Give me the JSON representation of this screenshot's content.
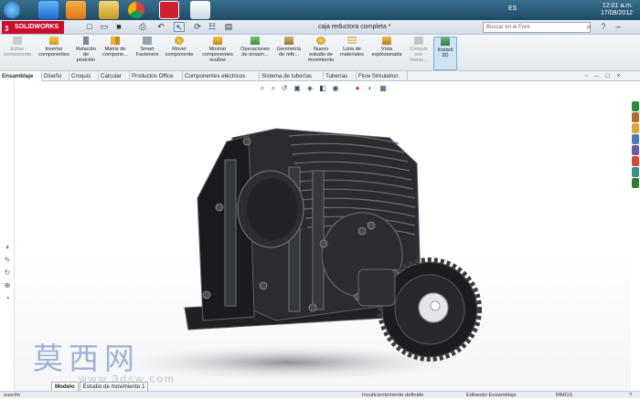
{
  "taskbar": {
    "language": "ES",
    "time": "12:01 a.m.",
    "date": "17/08/2012",
    "icons": [
      "start-orb-icon",
      "internet-explorer-icon",
      "media-player-icon",
      "explorer-icon",
      "chrome-icon",
      "solidworks-icon",
      "paint-icon"
    ]
  },
  "titlebar": {
    "app_name": "SOLIDWORKS",
    "document_title": "caja reductora completa *",
    "search_placeholder": "Buscar en el Foro"
  },
  "command_manager": {
    "buttons": [
      {
        "label": "Editar componente",
        "enabled": false
      },
      {
        "label": "Insertar componentes",
        "enabled": true
      },
      {
        "label": "Relación de posición",
        "enabled": true
      },
      {
        "label": "Matriz de compone...",
        "enabled": true
      },
      {
        "label": "Smart Fasteners",
        "enabled": true
      },
      {
        "label": "Mover componente",
        "enabled": true
      },
      {
        "label": "Mostrar componentes ocultos",
        "enabled": true
      },
      {
        "label": "Operaciones de ensam...",
        "enabled": true
      },
      {
        "label": "Geometría de refe...",
        "enabled": true
      },
      {
        "label": "Nuevo estudio de movimiento",
        "enabled": true
      },
      {
        "label": "Lista de materiales",
        "enabled": true
      },
      {
        "label": "Vista explosionada",
        "enabled": true
      },
      {
        "label": "Croquis con líneas...",
        "enabled": false
      },
      {
        "label": "Instant 3D",
        "enabled": true
      }
    ]
  },
  "tabs": [
    "Ensamblaje",
    "Diseño",
    "Croquis",
    "Calcular",
    "Productos Office",
    "Componentes eléctricos",
    "Sistema de tuberías",
    "Tuberías",
    "Flow Simulation"
  ],
  "active_tab": "Ensamblaje",
  "model_tabs": [
    "Modelo",
    "Estudio de movimiento 1"
  ],
  "status": {
    "left": "suscito",
    "definition": "Insuficientemente definido",
    "mode": "Editando Ensamblaje",
    "units": "MMGS"
  },
  "watermark": {
    "chinese": "莫西网",
    "url": "www.3dsw.com"
  }
}
